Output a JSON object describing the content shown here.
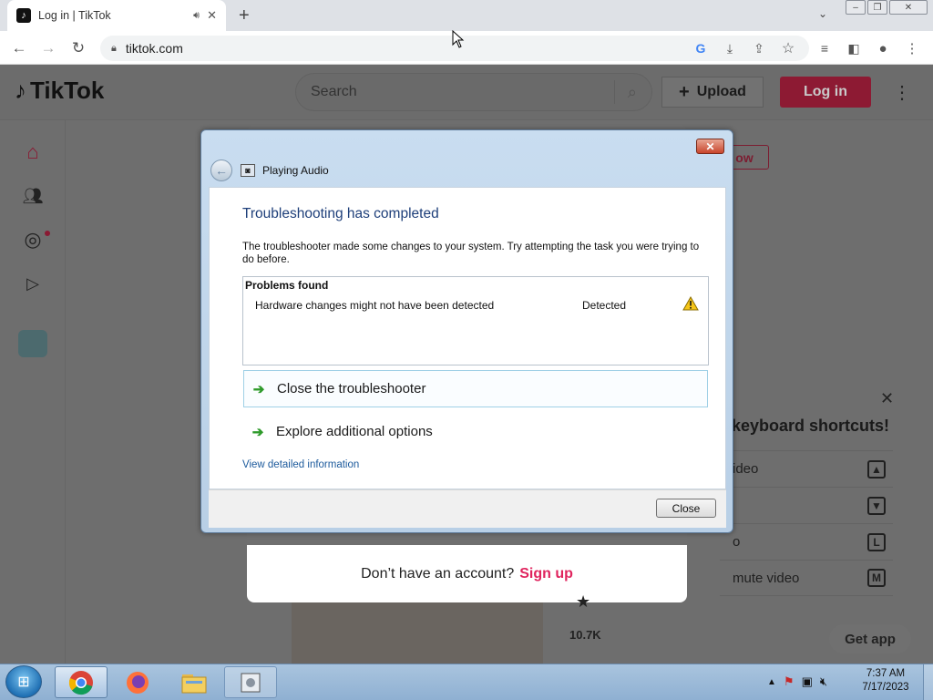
{
  "browser": {
    "tab_title": "Log in | TikTok",
    "url": "tiktok.com",
    "new_tab_label": "+",
    "icons": [
      "back-icon",
      "forward-icon",
      "reload-icon",
      "lock-icon",
      "google-icon",
      "download-icon",
      "share-icon",
      "star-icon",
      "media-icon",
      "sidepanel-icon",
      "profile-icon",
      "menu-icon"
    ]
  },
  "tiktok": {
    "logo": "TikTok",
    "search_placeholder": "Search",
    "upload_label": "Upload",
    "login_label": "Log in",
    "follow_label": "ow",
    "signup_prompt": "Don’t have an account?",
    "signup_link": "Sign up",
    "keyboard_title": "keyboard shortcuts!",
    "shortcuts": [
      {
        "label": "ideo",
        "key": "▲"
      },
      {
        "label": "",
        "key": "▼"
      },
      {
        "label": "o",
        "key": "L"
      },
      {
        "label": "mute video",
        "key": "M"
      }
    ],
    "likes_count": "10.7K",
    "get_app_label": "Get app"
  },
  "dialog": {
    "title": "Playing Audio",
    "heading": "Troubleshooting has completed",
    "description": "The troubleshooter made some changes to your system. Try attempting the task you were trying to do before.",
    "problems_header": "Problems found",
    "problems": [
      {
        "name": "Hardware changes might not have been detected",
        "status": "Detected"
      }
    ],
    "option_close": "Close the troubleshooter",
    "option_explore": "Explore additional options",
    "detail_link": "View detailed information",
    "close_button": "Close"
  },
  "taskbar": {
    "time": "7:37 AM",
    "date": "7/17/2023"
  },
  "colors": {
    "tiktok_red": "#fe2c55",
    "dialog_heading": "#1e3f7a",
    "link_blue": "#1c5a9c",
    "green_arrow": "#2e9a2a"
  }
}
